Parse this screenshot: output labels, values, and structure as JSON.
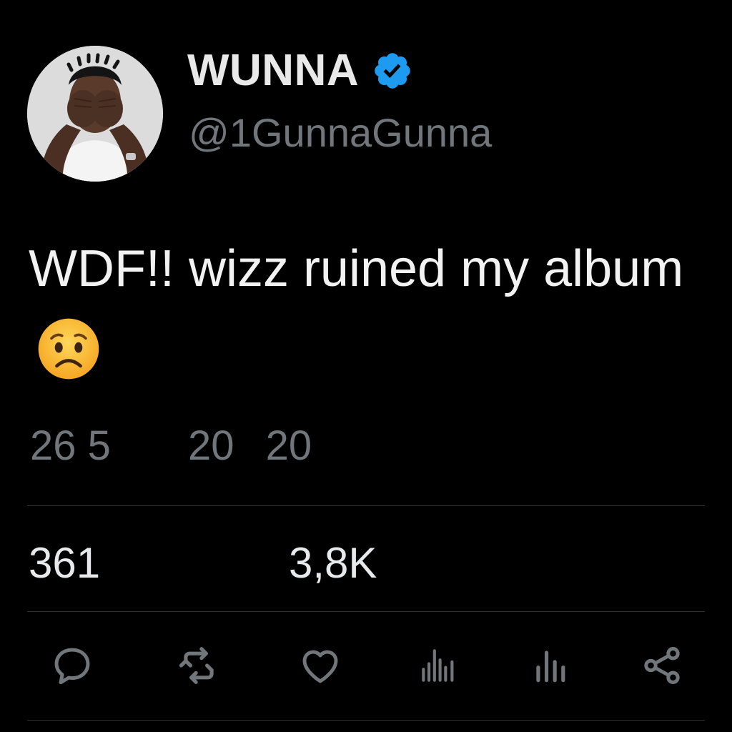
{
  "profile": {
    "display_name": "WUNNA",
    "handle": "@1GunnaGunna",
    "verified": true,
    "verified_color": "#1d9bf0"
  },
  "tweet": {
    "text": "WDF!! wizz ruined my album",
    "emoji": "worried-face"
  },
  "timestamp": {
    "part1": "26 5",
    "part2": "20",
    "part3": "20"
  },
  "stats": {
    "first": "361",
    "second": "3,8K"
  },
  "actions": [
    "reply-icon",
    "retweet-icon",
    "like-icon",
    "views-icon",
    "views-icon",
    "share-icon"
  ],
  "colors": {
    "background": "#000000",
    "text": "#e7e9ea",
    "secondary": "#71767b",
    "divider": "#2f3336"
  }
}
